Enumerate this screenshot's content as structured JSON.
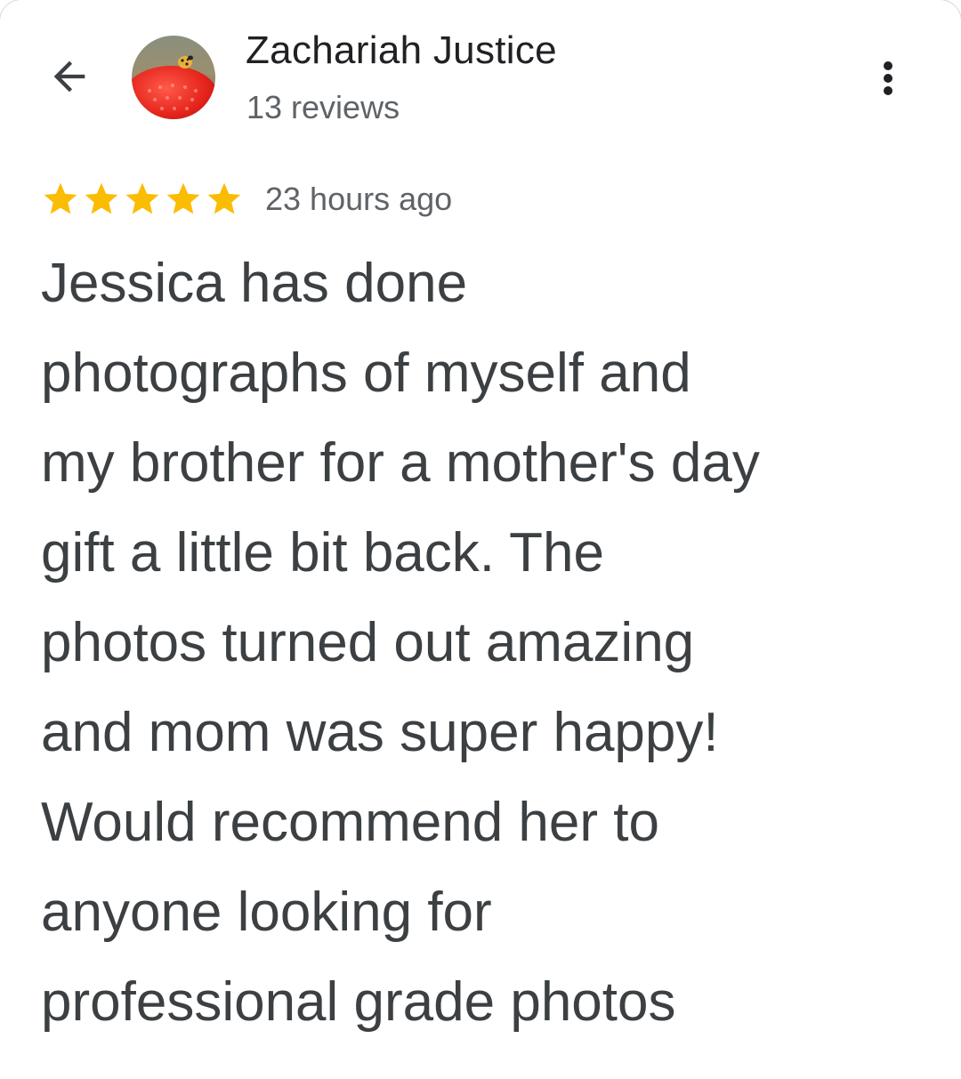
{
  "header": {
    "back_icon": "arrow-back-icon",
    "avatar_icon": "ladybug-photo-avatar",
    "reviewer_name": "Zachariah Justice",
    "review_count": "13 reviews",
    "more_icon": "more-vertical-icon"
  },
  "review": {
    "rating": 5,
    "rating_max": 5,
    "star_color": "#fbbc04",
    "time_ago": "23 hours ago",
    "text_lines": [
      "Jessica has done",
      "photographs of myself and",
      "my brother for a mother's day",
      "gift a little bit back. The",
      "photos turned out amazing",
      "and mom was super happy!",
      "Would recommend her to",
      "anyone looking for",
      "professional grade photos"
    ]
  },
  "colors": {
    "primary_text": "#202124",
    "secondary_text": "#5f6368",
    "body_text": "#3c4043"
  }
}
